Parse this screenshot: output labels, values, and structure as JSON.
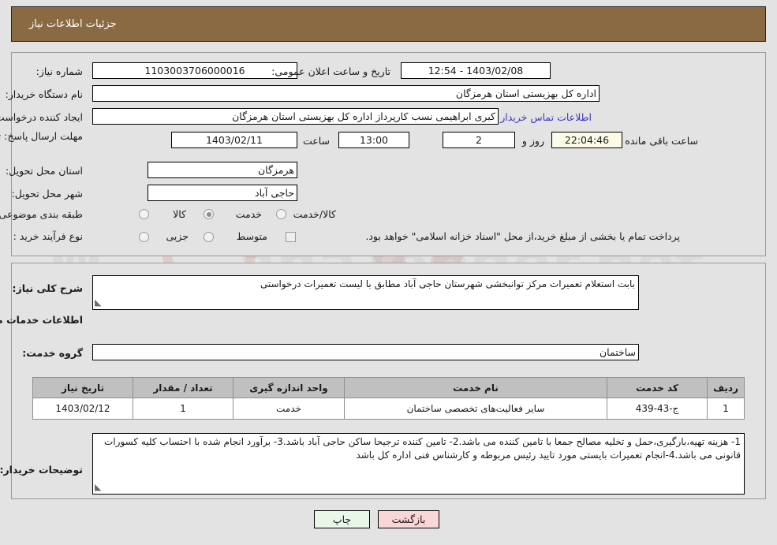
{
  "header": {
    "title": "جزئیات اطلاعات نیاز"
  },
  "form": {
    "need_number": {
      "label": "شماره نیاز:",
      "value": "1103003706000016"
    },
    "buyer_org": {
      "label": "نام دستگاه خریدار:",
      "value": "اداره کل بهزیستی استان هرمزگان"
    },
    "requester": {
      "label": "ایجاد کننده درخواست:",
      "value": "کبری  ابراهیمی نسب کارپرداز اداره کل بهزیستی استان هرمزگان"
    },
    "contact_link": "اطلاعات تماس خریدار",
    "public_announce": {
      "label": "تاریخ و ساعت اعلان عمومی:",
      "value": "1403/02/08 - 12:54"
    },
    "deadline": {
      "label": "مهلت ارسال پاسخ: تا تاریخ:",
      "date": "1403/02/11",
      "hour_label": "ساعت",
      "hour": "13:00",
      "days": "2",
      "days_label": "روز و",
      "countdown": "22:04:46",
      "remaining_label": "ساعت باقی مانده"
    },
    "province": {
      "label": "استان محل تحویل:",
      "value": "هرمزگان"
    },
    "city": {
      "label": "شهر محل تحویل:",
      "value": "حاجی آباد"
    },
    "category": {
      "label": "طبقه بندی موضوعی:",
      "options": [
        {
          "label": "کالا",
          "selected": false
        },
        {
          "label": "خدمت",
          "selected": true
        },
        {
          "label": "کالا/خدمت",
          "selected": false
        }
      ]
    },
    "purchase_type": {
      "label": "نوع فرآیند خرید :",
      "options": [
        {
          "label": "جزیی",
          "selected": false
        },
        {
          "label": "متوسط",
          "selected": false
        }
      ],
      "checkbox_label": "پرداخت تمام یا بخشی از مبلغ خرید،از محل \"اسناد خزانه اسلامی\" خواهد بود.",
      "checkbox_checked": false
    }
  },
  "sections": {
    "general_desc": {
      "label": "شرح کلی نیاز:",
      "value": "بابت استعلام تعمیرات مرکز توانبخشی شهرستان حاجی آباد مطابق با لیست تعمیرات درخواستی"
    },
    "services_heading": "اطلاعات خدمات مورد نیاز",
    "service_group": {
      "label": "گروه خدمت:",
      "value": "ساختمان"
    },
    "buyer_notes": {
      "label": "توضیحات خریدار:",
      "value": "1- هزینه تهیه،بارگیری،حمل و تخلیه مصالح جمعا با تامین کننده می باشد.2- تامین کننده ترجیحا ساکن حاجی آباد باشد.3- برآورد انجام شده با احتساب کلیه کسورات قانونی می باشد.4-انجام تعمیرات بایستی مورد تایید رئیس مربوطه و کارشناس فنی اداره کل باشد"
    }
  },
  "table": {
    "columns": [
      "ردیف",
      "کد خدمت",
      "نام خدمت",
      "واحد اندازه گیری",
      "تعداد / مقدار",
      "تاریخ نیاز"
    ],
    "rows": [
      [
        "1",
        "ج-43-439",
        "سایر فعالیت‌های تخصصی ساختمان",
        "خدمت",
        "1",
        "1403/02/12"
      ]
    ]
  },
  "footer": {
    "print_label": "چاپ",
    "back_label": "بازگشت"
  },
  "colors": {
    "header_bg": "#8a6a42",
    "page_bg": "#e3e3e3",
    "link": "#3b35c9",
    "print_btn": "#e9f7e9",
    "back_btn": "#fbd6d6",
    "table_header": "#c0c0c0",
    "countdown_bg": "#fbfbe8"
  }
}
